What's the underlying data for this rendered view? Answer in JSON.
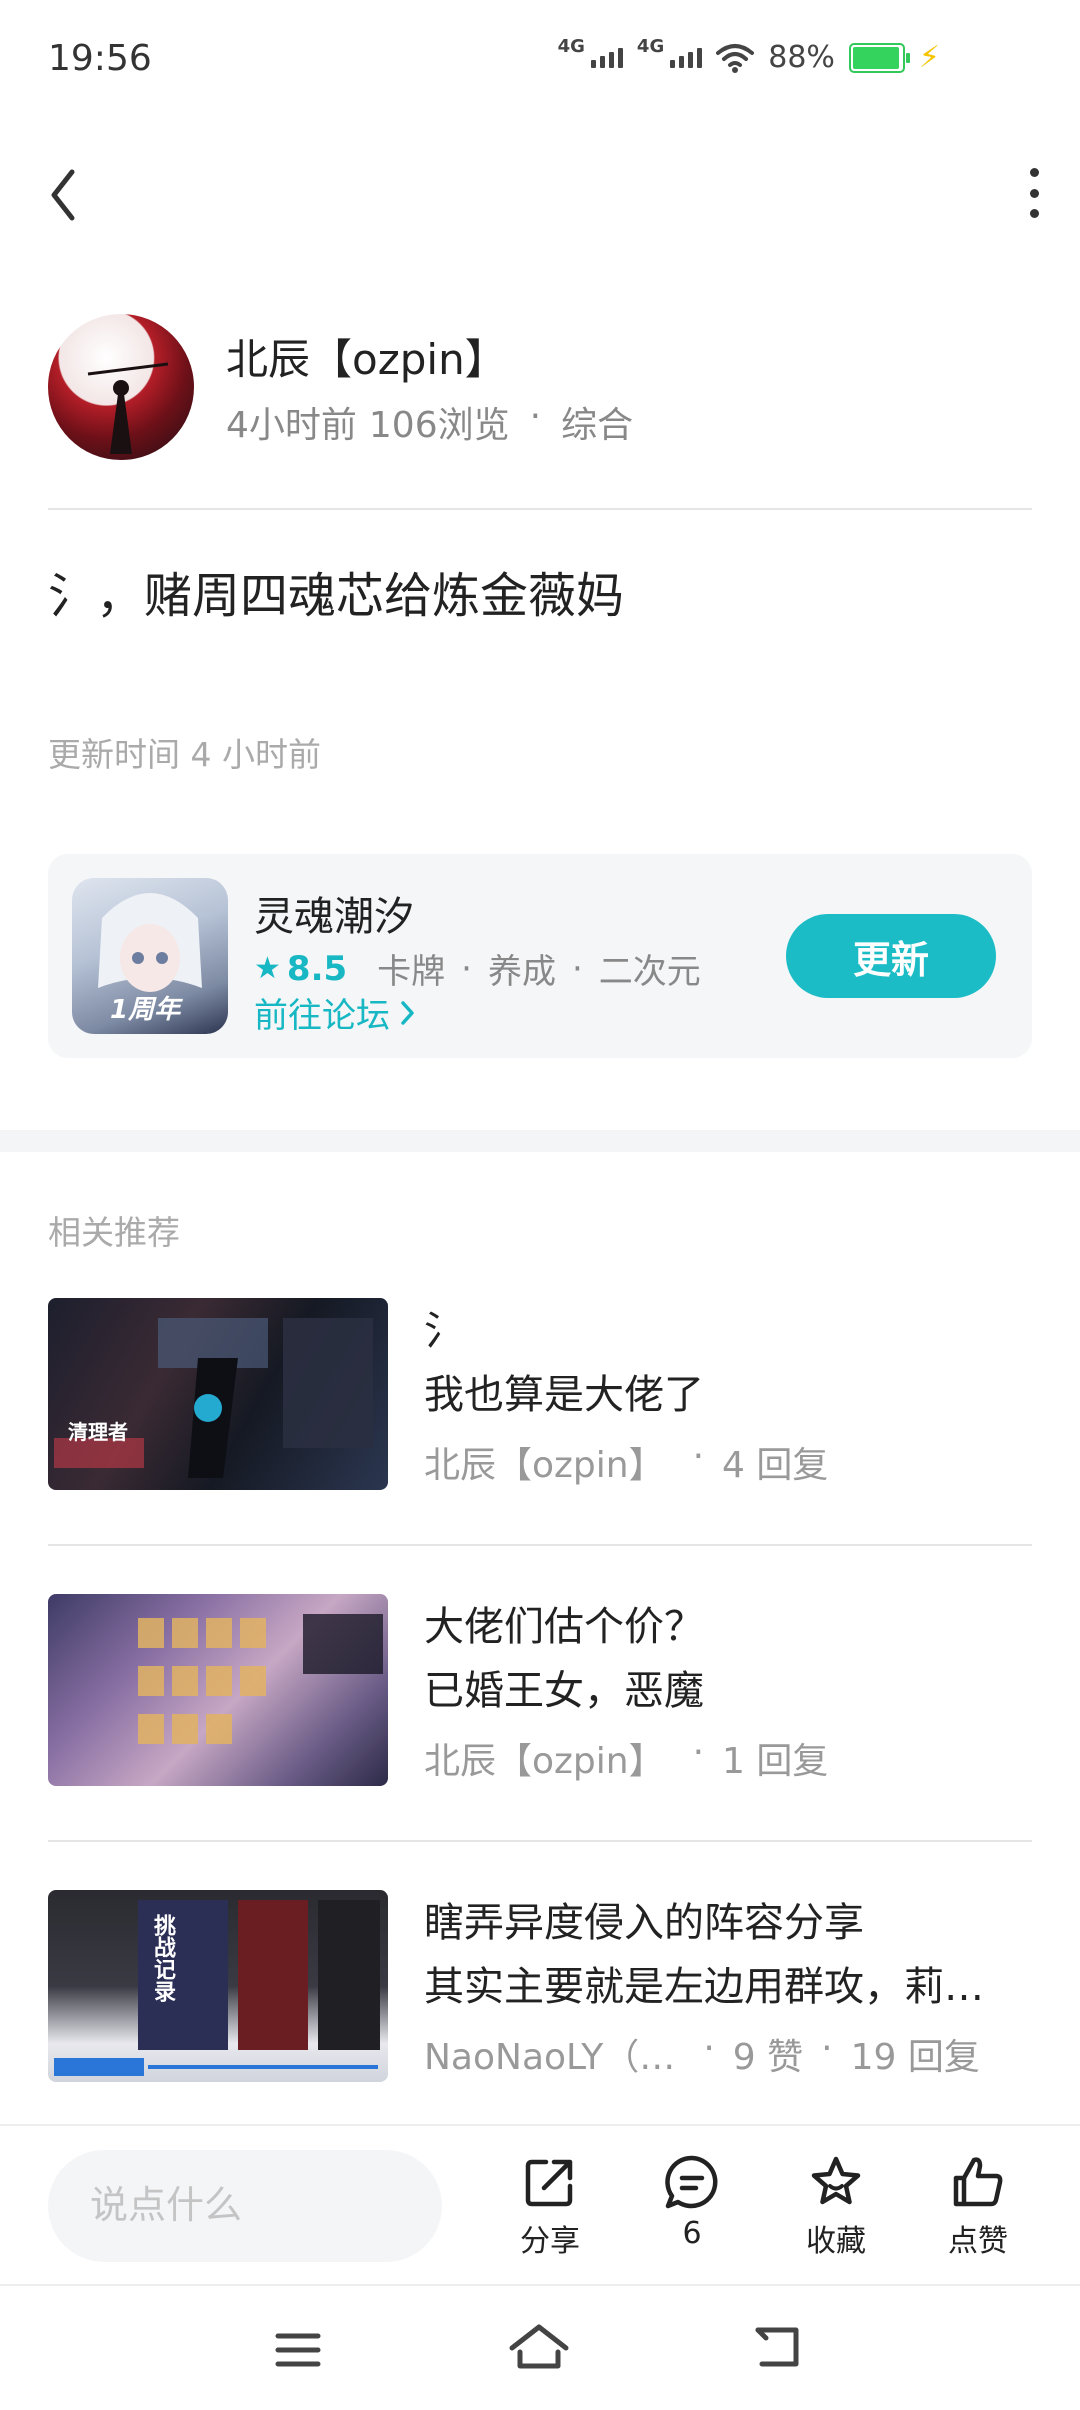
{
  "status_bar": {
    "time": "19:56",
    "network1": "4G",
    "network2": "4G",
    "battery": "88%"
  },
  "author": {
    "name": "北辰【ozpin】",
    "time": "4小时前",
    "views": "106浏览",
    "category": "综合"
  },
  "post": {
    "title": "氵，赌周四魂芯给炼金薇妈",
    "update_time": "更新时间 4 小时前"
  },
  "game": {
    "name": "灵魂潮汐",
    "rating": "8.5",
    "tags": [
      "卡牌",
      "养成",
      "二次元"
    ],
    "forum_link": "前往论坛",
    "update_button": "更新",
    "icon_badge": "1周年"
  },
  "recommend": {
    "section_title": "相关推荐",
    "items": [
      {
        "line1": "氵",
        "line2": "我也算是大佬了",
        "author": "北辰【ozpin】",
        "stats": "4 回复",
        "thumb_text": "清理者"
      },
      {
        "line1": "大佬们估个价？",
        "line2": "已婚王女，恶魔",
        "author": "北辰【ozpin】",
        "stats": "1 回复"
      },
      {
        "line1": "瞎弄异度侵入的阵容分享",
        "line2": "其实主要就是左边用群攻，莉…",
        "author": "NaoNaoLY（…",
        "stats": "9 赞",
        "stats2": "19 回复",
        "thumb_text": "挑战记录"
      }
    ]
  },
  "bottom_bar": {
    "comment_placeholder": "说点什么",
    "share_label": "分享",
    "comment_count": "6",
    "favorite_label": "收藏",
    "like_label": "点赞"
  },
  "colors": {
    "accent": "#1cbcc6",
    "battery": "#33d35e"
  }
}
